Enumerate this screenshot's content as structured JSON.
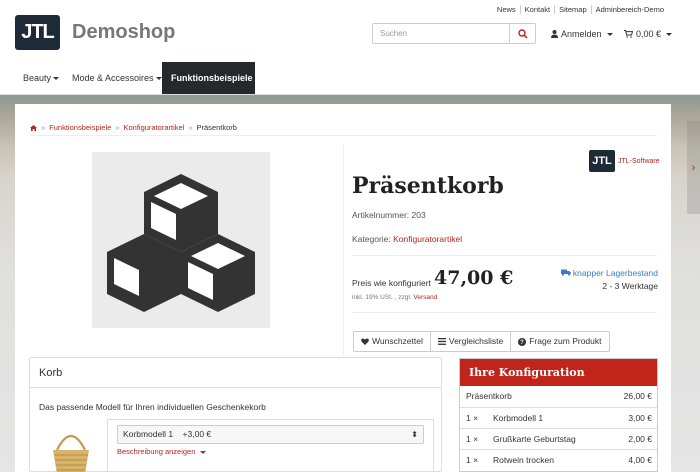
{
  "header": {
    "top_links": [
      "News",
      "Kontakt",
      "Sitemap",
      "Adminbereich-Demo"
    ],
    "logo_text": "JTL",
    "shop_name": "Demoshop",
    "search_placeholder": "Suchen",
    "login_label": "Anmelden",
    "cart_label": "0,00 €"
  },
  "nav": {
    "items": [
      "Beauty",
      "Mode & Accessoires",
      "Funktionsbeispiele"
    ],
    "active": "Funktionsbeispiele"
  },
  "breadcrumb": [
    "Funktionsbeispiele",
    "Konfiguratorartikel",
    "Präsentkorb"
  ],
  "product": {
    "manufacturer_logo": "JTL",
    "manufacturer": "JTL-Software",
    "title": "Präsentkorb",
    "article_number": "Artikelnummer: 203",
    "category_label": "Kategorie:",
    "category": "Konfiguratorartikel",
    "price_label": "Preis wie konfiguriert",
    "price": "47,00 €",
    "tax_note": "inkl. 19% USt. , zzgl.",
    "shipping_link": "Versand",
    "stock": "knapper Lagerbestand",
    "delivery": "2 - 3 Werktage",
    "actions": [
      "Wunschzettel",
      "Vergleichsliste",
      "Frage zum Produkt"
    ]
  },
  "korb": {
    "title": "Korb",
    "description": "Das passende Modell für Ihren individuellen Geschenkekorb",
    "selected": "Korbmodell 1",
    "selected_price": "+3,00 €",
    "description_link": "Beschreibung anzeigen"
  },
  "konfiguration": {
    "title": "Ihre Konfiguration",
    "base": {
      "name": "Präsentkorb",
      "price": "26,00 €"
    },
    "rows": [
      {
        "qty": "1 ×",
        "name": "Korbmodell 1",
        "price": "3,00 €"
      },
      {
        "qty": "1 ×",
        "name": "Grußkarte Geburtstag",
        "price": "2,00 €"
      },
      {
        "qty": "1 ×",
        "name": "Rotwein trocken",
        "price": "4,00 €"
      }
    ]
  },
  "colors": {
    "accent": "#b5261e",
    "header_dark": "#25282c",
    "konf_head": "#c0251c",
    "stock_blue": "#3a7bc8"
  }
}
